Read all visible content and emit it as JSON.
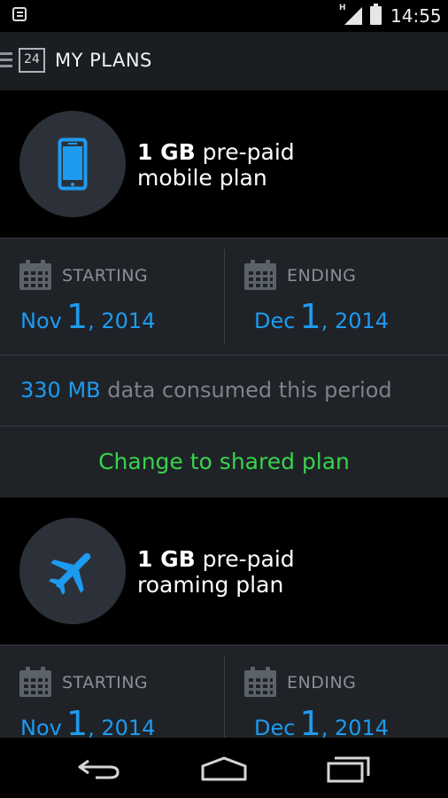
{
  "status_bar": {
    "time": "14:55",
    "network_letter": "H"
  },
  "action_bar": {
    "calendar_number": "24",
    "title": "MY PLANS"
  },
  "plans": [
    {
      "amount": "1 GB",
      "line1_rest": " pre-paid",
      "line2": "mobile plan",
      "icon": "smartphone-icon",
      "start_label": "STARTING",
      "start_month": "Nov",
      "start_day": "1",
      "start_year": ", 2014",
      "end_label": "ENDING",
      "end_month": "Dec",
      "end_day": "1",
      "end_year": ", 2014",
      "consumed_value": "330 MB",
      "consumed_text": " data consumed this period",
      "change_label": "Change to shared plan"
    },
    {
      "amount": "1 GB",
      "line1_rest": " pre-paid",
      "line2": "roaming plan",
      "icon": "airplane-icon",
      "start_label": "STARTING",
      "start_month": "Nov",
      "start_day": "1",
      "start_year": ", 2014",
      "end_label": "ENDING",
      "end_month": "Dec",
      "end_day": "1",
      "end_year": ", 2014"
    }
  ],
  "colors": {
    "accent_blue": "#1d9bf0",
    "accent_green": "#38d34a",
    "card_bg": "#1f2328"
  }
}
